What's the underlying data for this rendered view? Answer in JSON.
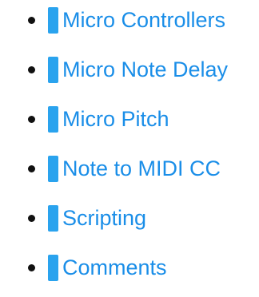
{
  "list": {
    "items": [
      {
        "label": "Micro Controllers"
      },
      {
        "label": "Micro Note Delay"
      },
      {
        "label": "Micro Pitch"
      },
      {
        "label": "Note to MIDI CC"
      },
      {
        "label": "Scripting"
      },
      {
        "label": "Comments"
      }
    ]
  },
  "colors": {
    "link": "#1a8ee8",
    "marker": "#2aa3ee",
    "bullet": "#111111"
  }
}
